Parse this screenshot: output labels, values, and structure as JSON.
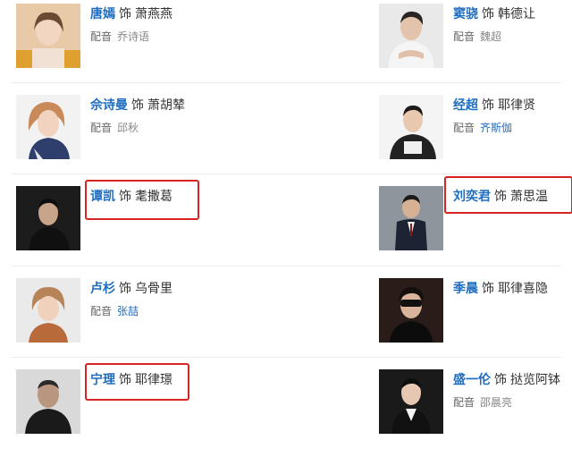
{
  "cast": [
    {
      "left": {
        "actor": "唐嫣",
        "as": "饰",
        "role": "萧燕燕",
        "dub_label": "配音",
        "dub": "乔诗语",
        "dub_link": false
      },
      "right": {
        "actor": "窦骁",
        "as": "饰",
        "role": "韩德让",
        "dub_label": "配音",
        "dub": "魏超",
        "dub_link": false
      }
    },
    {
      "left": {
        "actor": "佘诗曼",
        "as": "饰",
        "role": "萧胡辇",
        "dub_label": "配音",
        "dub": "邱秋",
        "dub_link": false
      },
      "right": {
        "actor": "经超",
        "as": "饰",
        "role": "耶律贤",
        "dub_label": "配音",
        "dub": "齐斯伽",
        "dub_link": true
      }
    },
    {
      "left": {
        "actor": "谭凯",
        "as": "饰",
        "role": "耄撒葛"
      },
      "right": {
        "actor": "刘奕君",
        "as": "饰",
        "role": "萧思温"
      }
    },
    {
      "left": {
        "actor": "卢杉",
        "as": "饰",
        "role": "乌骨里",
        "dub_label": "配音",
        "dub": "张喆",
        "dub_link": true
      },
      "right": {
        "actor": "季晨",
        "as": "饰",
        "role": "耶律喜隐"
      }
    },
    {
      "left": {
        "actor": "宁理",
        "as": "饰",
        "role": "耶律璟"
      },
      "right": {
        "actor": "盛一伦",
        "as": "饰",
        "role": "挞览阿钵",
        "dub_label": "配音",
        "dub": "邵晨亮",
        "dub_link": false
      }
    }
  ],
  "highlight_color": "#d62424"
}
